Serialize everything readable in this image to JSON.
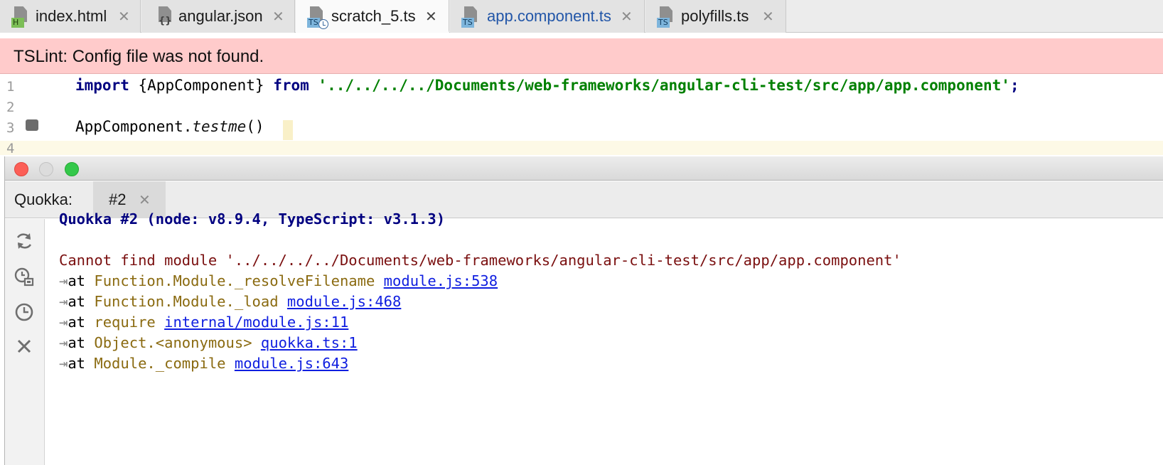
{
  "tabs": [
    {
      "label": "index.html",
      "icon": "html-file-icon",
      "badge": "H",
      "active": false
    },
    {
      "label": "angular.json",
      "icon": "json-file-icon",
      "badge": "{}",
      "active": false
    },
    {
      "label": "scratch_5.ts",
      "icon": "ts-scratch-file-icon",
      "badge": "TS",
      "active": true
    },
    {
      "label": "app.component.ts",
      "icon": "ts-file-icon",
      "badge": "TS",
      "active": false,
      "modified": true
    },
    {
      "label": "polyfills.ts",
      "icon": "ts-file-icon",
      "badge": "TS",
      "active": false
    }
  ],
  "banner": {
    "message": "TSLint: Config file was not found."
  },
  "editor": {
    "line_numbers": [
      "1",
      "2",
      "3",
      "4"
    ],
    "line1": {
      "kw_import": "import",
      "braces": "{AppComponent}",
      "kw_from": "from",
      "path": "'../../../../Documents/web-frameworks/angular-cli-test/src/app/app.component'",
      "semi": ";"
    },
    "line3": {
      "obj": "AppComponent.",
      "method": "testme",
      "parens": "()"
    }
  },
  "quokka": {
    "panel_label": "Quokka:",
    "tab_label": "#2",
    "header": "Quokka #2 (node: v8.9.4, TypeScript: v3.1.3)",
    "error": "Cannot find module '../../../../Documents/web-frameworks/angular-cli-test/src/app/app.component'",
    "trace": [
      {
        "at": "at",
        "fn": "Function.Module._resolveFilename",
        "link": "module.js:538"
      },
      {
        "at": "at",
        "fn": "Function.Module._load",
        "link": "module.js:468"
      },
      {
        "at": "at",
        "fn": "require",
        "link": "internal/module.js:11"
      },
      {
        "at": "at",
        "fn": "Object.<anonymous>",
        "link": "quokka.ts:1"
      },
      {
        "at": "at",
        "fn": "Module._compile",
        "link": "module.js:643"
      }
    ],
    "sidebar_icons": [
      "refresh-icon",
      "show-value-icon",
      "history-clock-icon",
      "close-icon"
    ]
  },
  "colors": {
    "banner_bg": "#ffcbcb",
    "keyword": "#000080",
    "string": "#008000",
    "error_text": "#7a0f0f",
    "link": "#0f1ee0"
  }
}
